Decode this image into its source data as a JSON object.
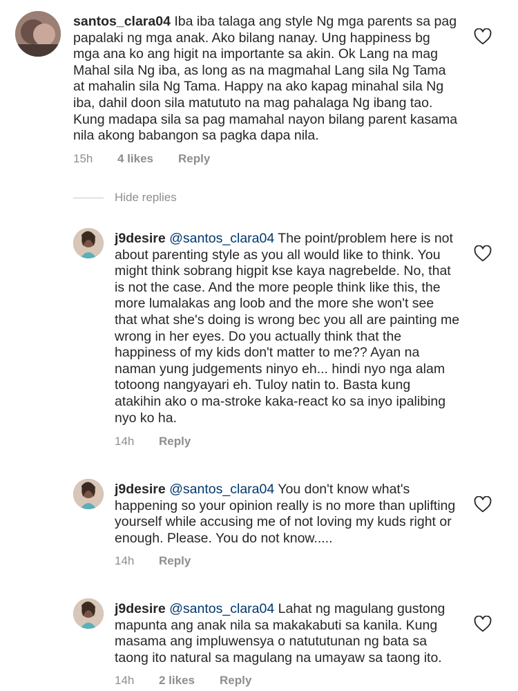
{
  "comments": [
    {
      "username": "santos_clara04",
      "mention": "",
      "text": "Iba iba talaga ang style Ng mga parents sa pag papalaki ng mga anak. Ako bilang nanay. Ung happiness bg mga ana ko ang higit na importante sa akin. Ok Lang na mag Mahal sila Ng iba, as long as na magmahal Lang sila Ng Tama at mahalin sila Ng Tama. Happy na ako kapag minahal sila Ng iba, dahil doon sila matututo na mag pahalaga Ng ibang tao. Kung madapa sila sa pag mamahal nayon bilang parent kasama nila akong babangon sa pagka dapa nila.",
      "time": "15h",
      "likes": "4 likes",
      "reply": "Reply"
    },
    {
      "username": "j9desire",
      "mention": "@santos_clara04",
      "text": "The point/problem here is not about parenting style as you all would like to think. You might think sobrang higpit kse kaya nagrebelde. No, that is not the case. And the more people think like this, the more lumalakas ang loob and the more she won't see that what she's doing is wrong bec you all are painting me wrong in her eyes. Do you actually think that the happiness of my kids don't matter to me?? Ayan na naman yung judgements ninyo eh... hindi nyo nga alam totoong nangyayari eh. Tuloy natin to. Basta kung atakihin ako o ma-stroke kaka-react ko sa inyo ipalibing nyo ko ha.",
      "time": "14h",
      "likes": "",
      "reply": "Reply"
    },
    {
      "username": "j9desire",
      "mention": "@santos_clara04",
      "text": "You don't know what's happening so your opinion really is no more than uplifting yourself while accusing me of not loving my kuds right or enough. Please. You do not know.....",
      "time": "14h",
      "likes": "",
      "reply": "Reply"
    },
    {
      "username": "j9desire",
      "mention": "@santos_clara04",
      "text": "Lahat ng magulang gustong mapunta ang anak nila sa makakabuti sa kanila. Kung masama ang impluwensya o natututunan ng bata sa taong ito natural sa magulang na umayaw sa taong ito.",
      "time": "14h",
      "likes": "2 likes",
      "reply": "Reply"
    }
  ],
  "hide_replies": "Hide replies",
  "colors": {
    "text": "#262626",
    "meta": "#8e8e8e",
    "mention": "#00376b"
  },
  "icons": {
    "like": "heart-outline-icon"
  }
}
